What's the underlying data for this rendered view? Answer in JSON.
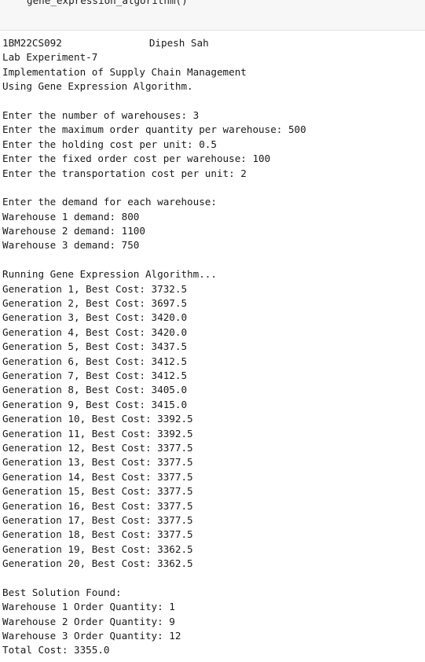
{
  "cell": {
    "code": "gene_expression_algorithm()"
  },
  "output": {
    "student_id": "1BM22CS092",
    "author": "Dipesh Sah",
    "experiment": "Lab Experiment-7",
    "title_line1": "Implementation of Supply Chain Management",
    "title_line2": "Using Gene Expression Algorithm.",
    "inputs": [
      "Enter the number of warehouses: 3",
      "Enter the maximum order quantity per warehouse: 500",
      "Enter the holding cost per unit: 0.5",
      "Enter the fixed order cost per warehouse: 100",
      "Enter the transportation cost per unit: 2"
    ],
    "demand_prompt": "Enter the demand for each warehouse:",
    "demands": [
      "Warehouse 1 demand: 800",
      "Warehouse 2 demand: 1100",
      "Warehouse 3 demand: 750"
    ],
    "running": "Running Gene Expression Algorithm...",
    "generations": [
      "Generation 1, Best Cost: 3732.5",
      "Generation 2, Best Cost: 3697.5",
      "Generation 3, Best Cost: 3420.0",
      "Generation 4, Best Cost: 3420.0",
      "Generation 5, Best Cost: 3437.5",
      "Generation 6, Best Cost: 3412.5",
      "Generation 7, Best Cost: 3412.5",
      "Generation 8, Best Cost: 3405.0",
      "Generation 9, Best Cost: 3415.0",
      "Generation 10, Best Cost: 3392.5",
      "Generation 11, Best Cost: 3392.5",
      "Generation 12, Best Cost: 3377.5",
      "Generation 13, Best Cost: 3377.5",
      "Generation 14, Best Cost: 3377.5",
      "Generation 15, Best Cost: 3377.5",
      "Generation 16, Best Cost: 3377.5",
      "Generation 17, Best Cost: 3377.5",
      "Generation 18, Best Cost: 3377.5",
      "Generation 19, Best Cost: 3362.5",
      "Generation 20, Best Cost: 3362.5"
    ],
    "best_header": "Best Solution Found:",
    "best_solution": [
      "Warehouse 1 Order Quantity: 1",
      "Warehouse 2 Order Quantity: 9",
      "Warehouse 3 Order Quantity: 12"
    ],
    "total_cost": "Total Cost: 3355.0"
  }
}
